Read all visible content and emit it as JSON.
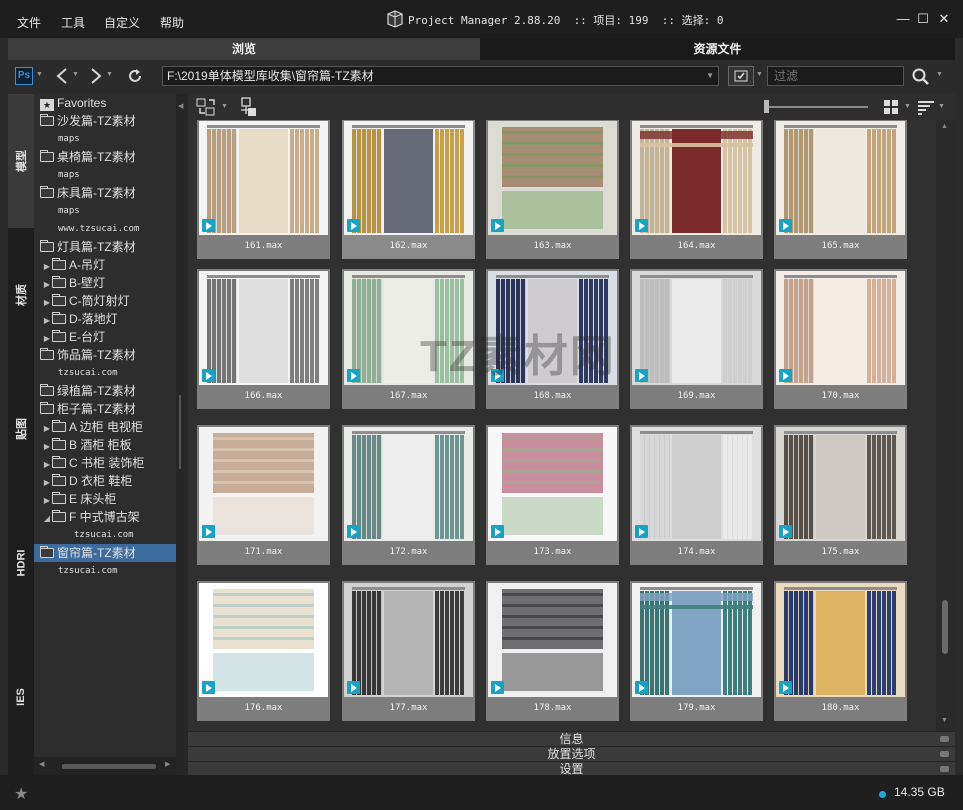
{
  "menu": [
    "文件",
    "工具",
    "自定义",
    "帮助"
  ],
  "app": {
    "title": "Project Manager 2.88.20  :: 项目: 199  :: 选择: 0"
  },
  "window_controls": {
    "minimize": "—",
    "maximize": "☐",
    "close": "✕"
  },
  "tabs": {
    "browse": "浏览",
    "assets": "资源文件"
  },
  "toolbar": {
    "ps_label": "Ps",
    "path": "F:\\2019单体模型库收集\\窗帘篇-TZ素材",
    "filter_placeholder": "过滤"
  },
  "side_tabs": [
    "模型",
    "材质",
    "贴图",
    "HDRI",
    "IES"
  ],
  "tree": [
    {
      "label": "Favorites",
      "icon": "star-icon",
      "level": 0,
      "arrow": ""
    },
    {
      "label": "沙发篇-TZ素材",
      "icon": "folder-icon",
      "level": 0,
      "arrow": ""
    },
    {
      "label": "maps",
      "icon": "",
      "level": 2,
      "arrow": "",
      "small": true
    },
    {
      "label": "桌椅篇-TZ素材",
      "icon": "folder-icon",
      "level": 0,
      "arrow": ""
    },
    {
      "label": "maps",
      "icon": "",
      "level": 2,
      "arrow": "",
      "small": true
    },
    {
      "label": "床具篇-TZ素材",
      "icon": "folder-icon",
      "level": 0,
      "arrow": ""
    },
    {
      "label": "maps",
      "icon": "",
      "level": 2,
      "arrow": "",
      "small": true
    },
    {
      "label": "www.tzsucai.com",
      "icon": "",
      "level": 2,
      "arrow": "",
      "small": true
    },
    {
      "label": "灯具篇-TZ素材",
      "icon": "folder-icon",
      "level": 0,
      "arrow": ""
    },
    {
      "label": "A-吊灯",
      "icon": "folder-icon",
      "level": 1,
      "arrow": "▶"
    },
    {
      "label": "B-壁灯",
      "icon": "folder-icon",
      "level": 1,
      "arrow": "▶"
    },
    {
      "label": "C-筒灯射灯",
      "icon": "folder-icon",
      "level": 1,
      "arrow": "▶"
    },
    {
      "label": "D-落地灯",
      "icon": "folder-icon",
      "level": 1,
      "arrow": "▶"
    },
    {
      "label": "E-台灯",
      "icon": "folder-icon",
      "level": 1,
      "arrow": "▶"
    },
    {
      "label": "饰品篇-TZ素材",
      "icon": "folder-icon",
      "level": 0,
      "arrow": ""
    },
    {
      "label": "tzsucai.com",
      "icon": "",
      "level": 2,
      "arrow": "",
      "small": true
    },
    {
      "label": "绿植篇-TZ素材",
      "icon": "folder-icon",
      "level": 0,
      "arrow": ""
    },
    {
      "label": "柜子篇-TZ素材",
      "icon": "folder-icon",
      "level": 0,
      "arrow": ""
    },
    {
      "label": "A 边柜 电视柜",
      "icon": "folder-icon",
      "level": 1,
      "arrow": "▶"
    },
    {
      "label": "B 酒柜 柜板",
      "icon": "folder-icon",
      "level": 1,
      "arrow": "▶"
    },
    {
      "label": "C 书柜 装饰柜",
      "icon": "folder-icon",
      "level": 1,
      "arrow": "▶"
    },
    {
      "label": "D 衣柜 鞋柜",
      "icon": "folder-icon",
      "level": 1,
      "arrow": "▶"
    },
    {
      "label": "E 床头柜",
      "icon": "folder-icon",
      "level": 1,
      "arrow": "▶"
    },
    {
      "label": "F 中式博古架",
      "icon": "folder-icon",
      "level": 1,
      "arrow": "◢"
    },
    {
      "label": "tzsucai.com",
      "icon": "",
      "level": 3,
      "arrow": "",
      "small": true
    },
    {
      "label": "窗帘篇-TZ素材",
      "icon": "folder-icon",
      "level": 0,
      "arrow": "",
      "selected": true
    },
    {
      "label": "tzsucai.com",
      "icon": "",
      "level": 2,
      "arrow": "",
      "small": true
    }
  ],
  "items": [
    {
      "name": "161.max",
      "style": "tied-cream"
    },
    {
      "name": "162.max",
      "style": "gold-navy"
    },
    {
      "name": "163.max",
      "style": "roman-khaki"
    },
    {
      "name": "164.max",
      "style": "striped-beige"
    },
    {
      "name": "165.max",
      "style": "tan-sheer"
    },
    {
      "name": "166.max",
      "style": "grey-sheer"
    },
    {
      "name": "167.max",
      "style": "floral-green"
    },
    {
      "name": "168.max",
      "style": "navy-lace"
    },
    {
      "name": "169.max",
      "style": "white-window"
    },
    {
      "name": "170.max",
      "style": "peach-room"
    },
    {
      "name": "171.max",
      "style": "roman-fold"
    },
    {
      "name": "172.max",
      "style": "teal-sheer"
    },
    {
      "name": "173.max",
      "style": "floral-roman"
    },
    {
      "name": "174.max",
      "style": "white-panel"
    },
    {
      "name": "175.max",
      "style": "dark-grey"
    },
    {
      "name": "176.max",
      "style": "roman-swatch"
    },
    {
      "name": "177.max",
      "style": "black-grey"
    },
    {
      "name": "178.max",
      "style": "roman-grid"
    },
    {
      "name": "179.max",
      "style": "teal-valance"
    },
    {
      "name": "180.max",
      "style": "blue-gold"
    }
  ],
  "watermark": "TZ素材网",
  "panels": [
    "信息",
    "放置选项",
    "设置"
  ],
  "status": {
    "disk": "14.35 GB"
  },
  "colors": {
    "accent": "#1fa7e1",
    "selection": "#3c6b9e",
    "max_badge": "#17a4c4"
  }
}
